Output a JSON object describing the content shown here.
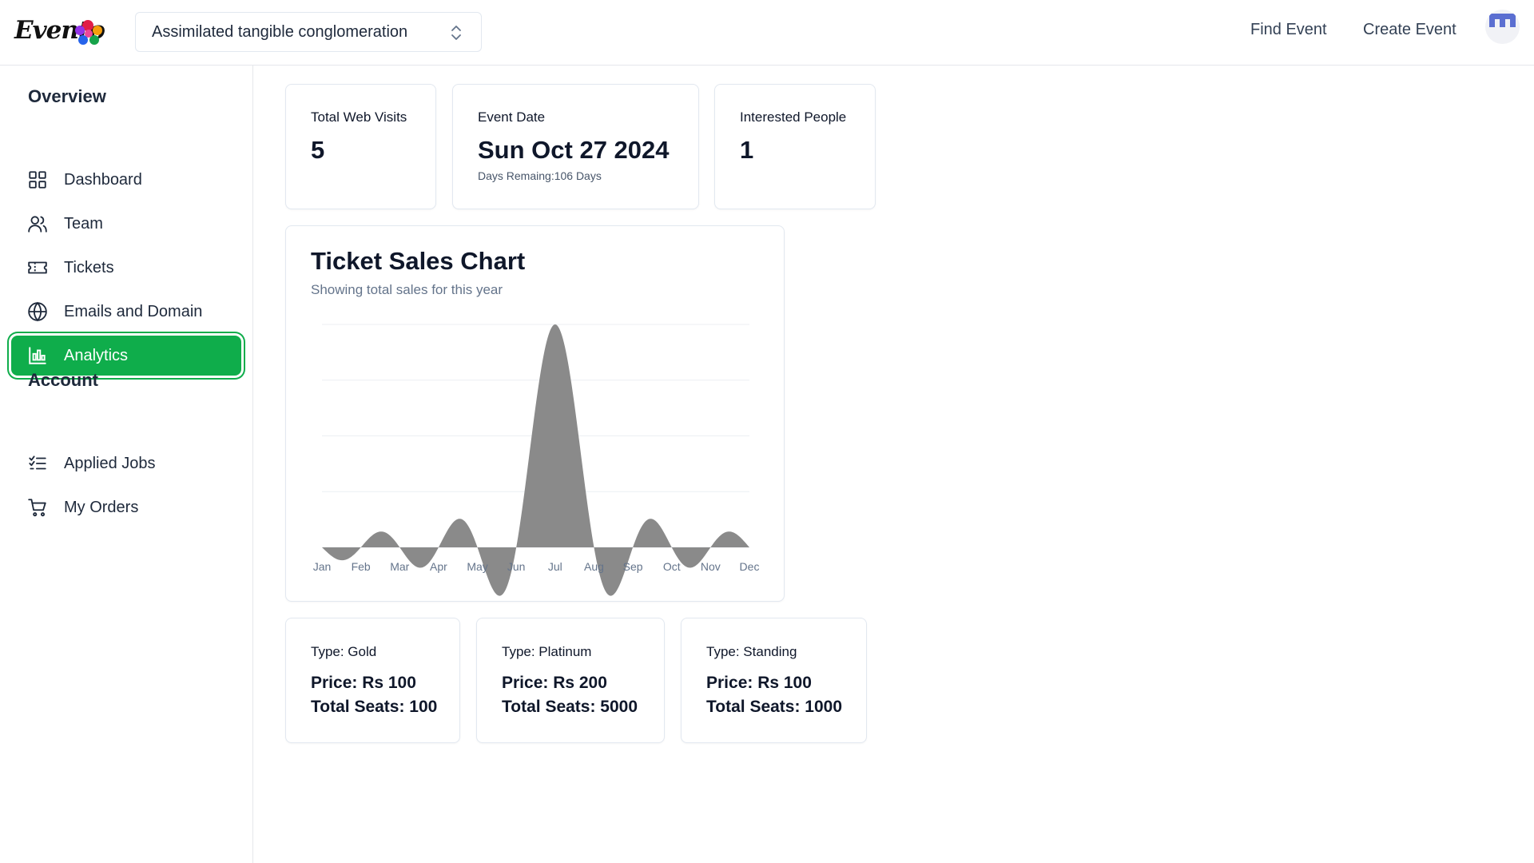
{
  "header": {
    "logo_text": "Evento",
    "project_select": "Assimilated tangible conglomeration",
    "nav_find": "Find Event",
    "nav_create": "Create Event"
  },
  "sidebar": {
    "overview_title": "Overview",
    "overview_items": [
      {
        "label": "Dashboard",
        "icon": "dashboard-grid-icon"
      },
      {
        "label": "Team",
        "icon": "users-icon"
      },
      {
        "label": "Tickets",
        "icon": "ticket-icon"
      },
      {
        "label": "Emails and Domain",
        "icon": "globe-icon"
      },
      {
        "label": "Analytics",
        "icon": "bar-chart-icon",
        "active": true
      }
    ],
    "account_title": "Account",
    "account_items": [
      {
        "label": "Applied Jobs",
        "icon": "checklist-icon"
      },
      {
        "label": "My Orders",
        "icon": "cart-icon"
      }
    ]
  },
  "stats": {
    "web_visits_label": "Total Web Visits",
    "web_visits_value": "5",
    "event_date_label": "Event Date",
    "event_date_value": "Sun Oct 27 2024",
    "days_remaining": "Days Remaing:106 Days",
    "interested_label": "Interested People",
    "interested_value": "1"
  },
  "chart_data": {
    "type": "area",
    "title": "Ticket Sales Chart",
    "subtitle": "Showing total sales for this year",
    "categories": [
      "Jan",
      "Feb",
      "Mar",
      "Apr",
      "May",
      "Jun",
      "Jul",
      "Aug",
      "Sep",
      "Oct",
      "Nov",
      "Dec"
    ],
    "values": [
      0,
      0,
      0,
      0,
      0,
      0,
      5,
      0,
      0,
      0,
      0,
      0
    ],
    "grid": true,
    "color": "#8a8a8a"
  },
  "tickets": [
    {
      "type": "Type: Gold",
      "price": "Price: Rs 100",
      "seats": "Total Seats: 100"
    },
    {
      "type": "Type: Platinum",
      "price": "Price: Rs 200",
      "seats": "Total Seats: 5000"
    },
    {
      "type": "Type: Standing",
      "price": "Price: Rs 100",
      "seats": "Total Seats: 1000"
    }
  ],
  "colors": {
    "accent": "#0fad4b",
    "avatar_icon": "#5b6fd1"
  }
}
